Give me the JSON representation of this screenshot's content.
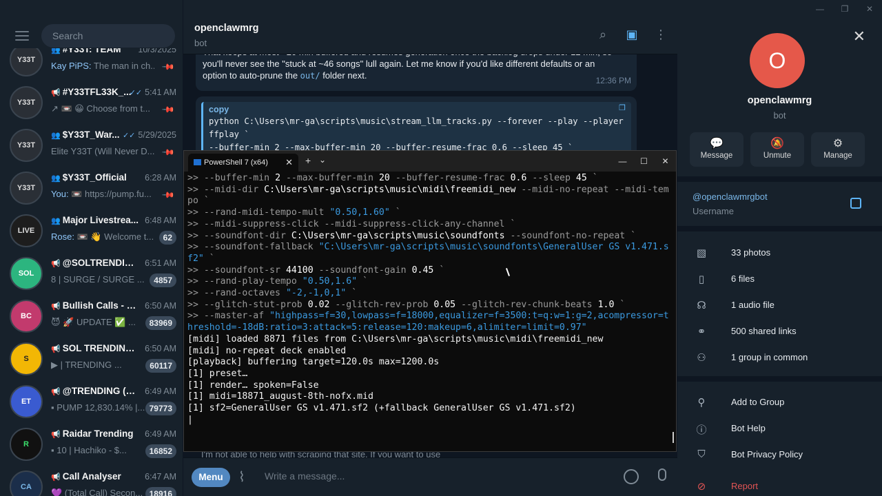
{
  "window": {
    "minimize": "—",
    "maximize": "❐",
    "close": "✕"
  },
  "sidebar": {
    "search_placeholder": "Search",
    "chats": [
      {
        "avatar": "Y33T",
        "icon": "👥",
        "name": "#Y33T: TEAM",
        "time": "10/3/2025",
        "who": "Kay PiPS:",
        "preview": " The man in ch...",
        "badge": "",
        "pinned": true,
        "check": false
      },
      {
        "avatar": "Y33T",
        "icon": "📢",
        "name": "#Y33TFL33K_...",
        "time": "5:41 AM",
        "who": "",
        "preview": "↗ 📼 😀 Choose from t...",
        "badge": "",
        "pinned": true,
        "check": true
      },
      {
        "avatar": "Y33T",
        "icon": "👥",
        "name": "$Y33T_War...",
        "time": "5/29/2025",
        "who": "",
        "preview": "Elite Y33T (Will Never D...",
        "badge": "",
        "pinned": true,
        "check": true
      },
      {
        "avatar": "Y33T",
        "icon": "👥",
        "name": "$Y33T_Official",
        "time": "6:28 AM",
        "who": "You:",
        "preview": " 📼 https://pump.fu...",
        "badge": "",
        "pinned": true,
        "check": false
      },
      {
        "avatar": "LIVE",
        "icon": "👥",
        "name": "Major Livestrea...",
        "time": "6:48 AM",
        "who": "Rose:",
        "preview": " 📼 👋 Welcome t...",
        "badge": "62",
        "pinned": false,
        "check": false
      },
      {
        "avatar": "SOL",
        "icon": "📢",
        "name": "@SOLTRENDING...",
        "time": "6:51 AM",
        "who": "",
        "preview": "8 | SURGE / SURGE ...",
        "badge": "4857",
        "pinned": false,
        "check": false
      },
      {
        "avatar": "BC",
        "icon": "📢",
        "name": "Bullish Calls - Sol...",
        "time": "6:50 AM",
        "who": "",
        "preview": "😈 🚀 UPDATE ✅ ...",
        "badge": "83969",
        "pinned": false,
        "check": false
      },
      {
        "avatar": "S",
        "icon": "📢",
        "name": "SOL TRENDING ...",
        "time": "6:50 AM",
        "who": "",
        "preview": "▶ | TRENDING ...",
        "badge": "60117",
        "pinned": false,
        "check": false
      },
      {
        "avatar": "ET",
        "icon": "📢",
        "name": "@TRENDING (ET...",
        "time": "6:49 AM",
        "who": "",
        "preview": "▪ PUMP 12,830.14% |...",
        "badge": "79773",
        "pinned": false,
        "check": false
      },
      {
        "avatar": "R",
        "icon": "📢",
        "name": "Raidar Trending",
        "time": "6:49 AM",
        "who": "",
        "preview": "▪ 10 | Hachiko - $...",
        "badge": "16852",
        "pinned": false,
        "check": false
      },
      {
        "avatar": "CA",
        "icon": "📢",
        "name": "Call Analyser",
        "time": "6:47 AM",
        "who": "",
        "preview": "💜 (Total Call) Secon...",
        "badge": "18916",
        "pinned": false,
        "check": false
      }
    ]
  },
  "chat": {
    "title": "openclawmrg",
    "subtitle": "bot",
    "message_lines": [
      "That keeps at most ~20 min buffered and resumes generation once the backlog drops under 12 min, so",
      "you'll never see the \"stuck at ~46 songs\" lull again. Let me know if you'd like different defaults or an",
      "option to auto-prune the "
    ],
    "message_code": "out/",
    "message_tail": " folder next.",
    "message_time": "12:36 PM",
    "code_lang": "copy",
    "code_lines": [
      "python C:\\Users\\mr-ga\\scripts\\music\\stream_llm_tracks.py --forever --play --player",
      "ffplay `",
      "--buffer-min 2 --max-buffer-min 20 --buffer-resume-frac 0.6 --sleep 45 `"
    ],
    "bottom_preview": "I'm not able to help with scraping that site. If you want to use",
    "menu_label": "Menu",
    "compose_placeholder": "Write a message..."
  },
  "terminal": {
    "tab_title": "PowerShell 7 (x64)",
    "tab_close": "✕",
    "plus": "+",
    "dropdown": "⌄"
  },
  "profile": {
    "avatar_letter": "O",
    "name": "openclawmrg",
    "subtitle": "bot",
    "actions": [
      {
        "icon": "💬",
        "label": "Message"
      },
      {
        "icon": "🔕",
        "label": "Unmute"
      },
      {
        "icon": "⚙",
        "label": "Manage"
      }
    ],
    "username": "@openclawmrgbot",
    "username_label": "Username",
    "media": [
      {
        "icon": "🖼",
        "label": "33 photos"
      },
      {
        "icon": "📄",
        "label": "6 files"
      },
      {
        "icon": "🎧",
        "label": "1 audio file"
      },
      {
        "icon": "🔗",
        "label": "500 shared links"
      },
      {
        "icon": "👥",
        "label": "1 group in common"
      }
    ],
    "bot_actions": [
      {
        "icon": "👤+",
        "label": "Add to Group"
      },
      {
        "icon": "ⓘ",
        "label": "Bot Help"
      },
      {
        "icon": "🛡",
        "label": "Bot Privacy Policy"
      },
      {
        "icon": "!",
        "label": "Report"
      }
    ]
  }
}
